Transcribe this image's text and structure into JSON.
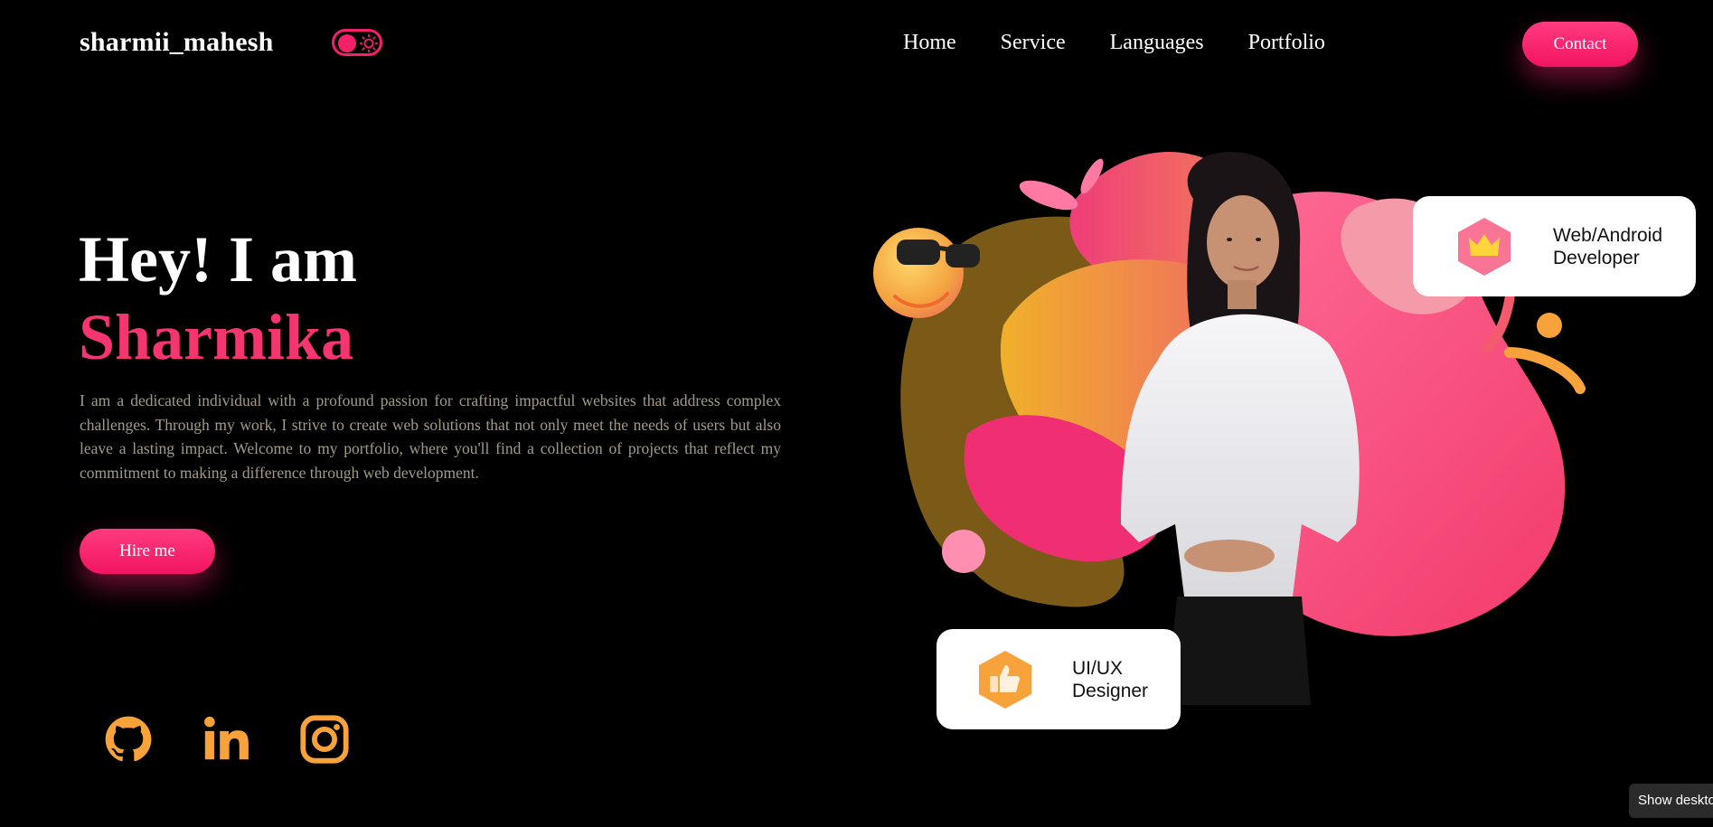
{
  "header": {
    "brand": "sharmii_mahesh",
    "nav": [
      "Home",
      "Service",
      "Languages",
      "Portfolio"
    ],
    "contact_label": "Contact"
  },
  "hero": {
    "greeting": "Hey! I am",
    "name": "Sharmika",
    "bio": "I am a dedicated individual with a profound passion for crafting impactful websites that address complex challenges. Through my work, I strive to create web solutions that not only meet the needs of users but also leave a lasting impact. Welcome to my portfolio, where you'll find a collection of projects that reflect my commitment to making a difference through web development.",
    "hire_label": "Hire me"
  },
  "cards": {
    "web_line1": "Web/Android",
    "web_line2": "Developer",
    "ui_line1": "UI/UX",
    "ui_line2": "Designer"
  },
  "social": [
    "github-icon",
    "linkedin-icon",
    "instagram-icon"
  ],
  "colors": {
    "accent": "#f5206a",
    "social": "#f7a23a",
    "background": "#000000",
    "bio_text": "#a39a89"
  },
  "overlay": {
    "desktop_button": "Show desktop"
  }
}
